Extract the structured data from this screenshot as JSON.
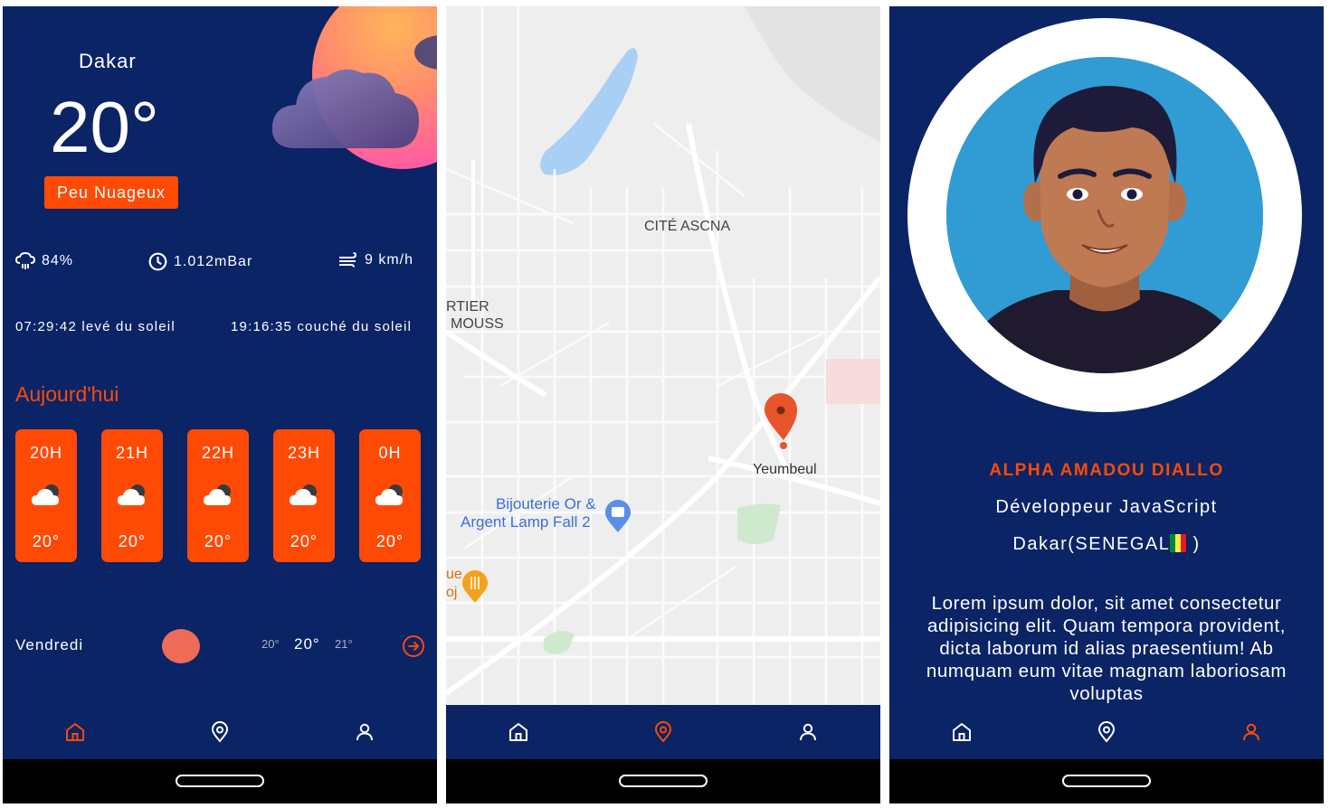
{
  "colors": {
    "navy": "#0a2466",
    "accent": "#ff4a06",
    "map_bg": "#eeeeee",
    "avatar_bg": "#319bd4"
  },
  "nav": {
    "icons": [
      "home-icon",
      "location-pin-icon",
      "user-icon"
    ]
  },
  "weather": {
    "city": "Dakar",
    "temperature": "20°",
    "condition": "Peu Nuageux",
    "humidity": "84%",
    "pressure": "1.012mBar",
    "wind": "9 km/h",
    "sunrise": "07:29:42 levé du soleil",
    "sunset": "19:16:35 couché du soleil",
    "today_label": "Aujourd'hui",
    "hourly": [
      {
        "hour": "20H",
        "temp": "20°"
      },
      {
        "hour": "21H",
        "temp": "20°"
      },
      {
        "hour": "22H",
        "temp": "20°"
      },
      {
        "hour": "23H",
        "temp": "20°"
      },
      {
        "hour": "0H",
        "temp": "20°"
      }
    ],
    "daily": {
      "day": "Vendredi",
      "min": "20°",
      "temp": "20°",
      "max": "21°"
    }
  },
  "map": {
    "labels": {
      "district": "CITÉ ASCNA",
      "left_top": "RTIER",
      "left_bottom": "MOUSS",
      "place": "Yeumbeul",
      "shop_line1": "Bijouterie Or &",
      "shop_line2": "Argent Lamp Fall 2",
      "food_line1": "ue",
      "food_line2": "oj"
    }
  },
  "profile": {
    "name": "ALPHA AMADOU DIALLO",
    "role": "Développeur JavaScript",
    "location": "Dakar(SENEGAL",
    "location_end": " )",
    "bio": "Lorem ipsum dolor, sit amet consectetur adipisicing elit. Quam tempora provident, dicta laborum id alias praesentium! Ab numquam eum vitae magnam laboriosam voluptas"
  }
}
